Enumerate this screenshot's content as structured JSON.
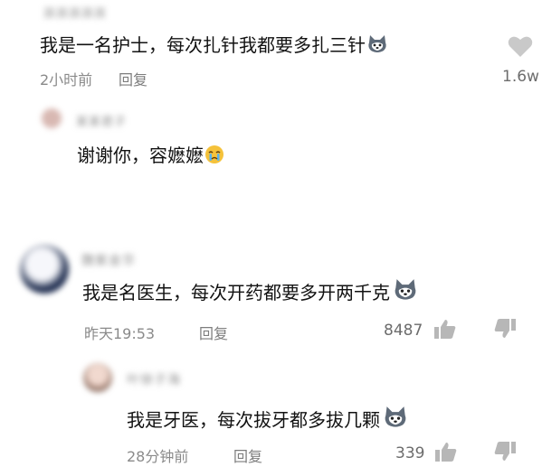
{
  "comments": [
    {
      "username": "孩孩孩孩孩",
      "text": "我是一名护士，每次扎针我都要多扎三针",
      "time": "2小时前",
      "reply_label": "回复",
      "likes": "1.6w",
      "reply": {
        "username": "某某君子",
        "text": "谢谢你，容嬷嬷"
      }
    },
    {
      "username": "魏紫金华",
      "text": "我是名医生，每次开药都要多开两千克",
      "time": "昨天19:53",
      "reply_label": "回复",
      "likes": "8487",
      "reply": {
        "username": "叶徐子海",
        "text": "我是牙医，每次拔牙都多拔几颗",
        "time": "28分钟前",
        "reply_label": "回复",
        "likes": "339"
      }
    }
  ],
  "icons": {
    "heart": "heart-icon",
    "thumb_up": "thumb-up-icon",
    "thumb_down": "thumb-down-icon",
    "husky_emoji": "husky-emoji-icon",
    "crying_emoji": "crying-emoji-icon"
  },
  "colors": {
    "heart_gray": "#c9c9c9",
    "meta_gray": "#8a8a8a",
    "icon_gray": "#b7b7b7"
  }
}
